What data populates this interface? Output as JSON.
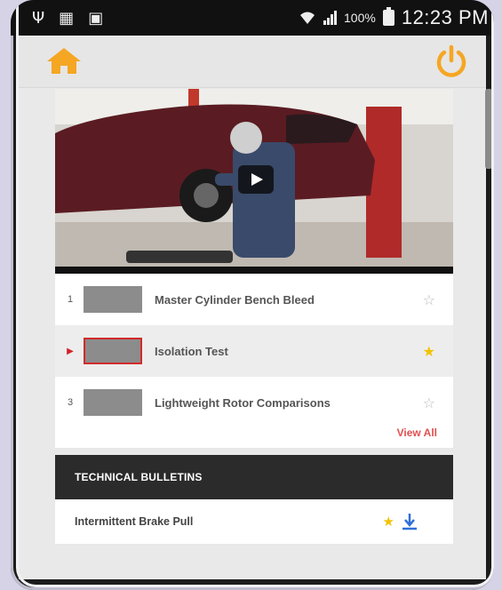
{
  "statusbar": {
    "battery_percent": "100%",
    "time": "12:23 PM",
    "icons": [
      "usb-icon",
      "notification-icon",
      "briefcase-icon",
      "wifi-icon",
      "signal-icon",
      "battery-icon"
    ]
  },
  "appbar": {
    "left_icon": "home-icon",
    "right_icon": "power-icon",
    "accent_color": "#f5a623"
  },
  "video": {
    "state": "paused",
    "thumbnail_description_icon": "play-icon"
  },
  "playlist": {
    "items": [
      {
        "index": "1",
        "title": "Master Cylinder Bench Bleed",
        "favorite": false,
        "active": false
      },
      {
        "index": "",
        "title": "Isolation Test",
        "favorite": true,
        "active": true
      },
      {
        "index": "3",
        "title": "Lightweight Rotor Comparisons",
        "favorite": false,
        "active": false
      }
    ],
    "view_all_label": "View All"
  },
  "bulletins": {
    "header": "TECHNICAL BULLETINS",
    "items": [
      {
        "title": "Intermittent Brake Pull",
        "favorite": true
      }
    ]
  },
  "colors": {
    "active_marker": "#d3222a",
    "star_on": "#f2c200",
    "view_all": "#e05050",
    "download": "#2f6fd6"
  }
}
